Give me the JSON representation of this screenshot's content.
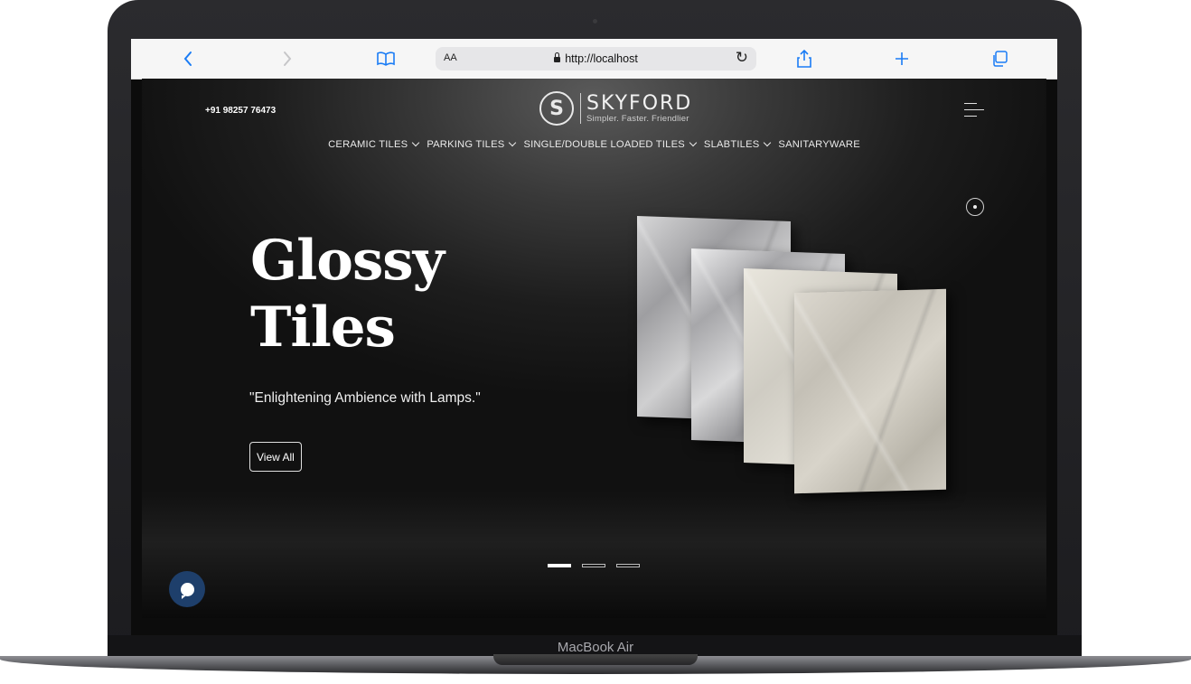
{
  "browser": {
    "text_size_label": "AA",
    "url": "http://localhost"
  },
  "site": {
    "phone": "+91 98257 76473",
    "logo": {
      "mark": "S",
      "name": "SKYFORD",
      "tagline": "Simpler. Faster. Friendlier"
    },
    "nav": [
      {
        "label": "CERAMIC TILES",
        "has_dropdown": true
      },
      {
        "label": "PARKING TILES",
        "has_dropdown": true
      },
      {
        "label": "SINGLE/DOUBLE LOADED TILES",
        "has_dropdown": true
      },
      {
        "label": "SLABTILES",
        "has_dropdown": true
      },
      {
        "label": "SANITARYWARE",
        "has_dropdown": false
      }
    ],
    "hero": {
      "title_line1": "Glossy",
      "title_line2": "Tiles",
      "subtitle": "\"Enlightening Ambience with Lamps.\"",
      "cta": "View All",
      "slide_count": 3,
      "active_slide": 1
    }
  },
  "device_label": "MacBook Air",
  "colors": {
    "browser_accent": "#1a7cf5",
    "chat_button": "#1e3f6b",
    "page_bg": "#1d1d1d"
  }
}
